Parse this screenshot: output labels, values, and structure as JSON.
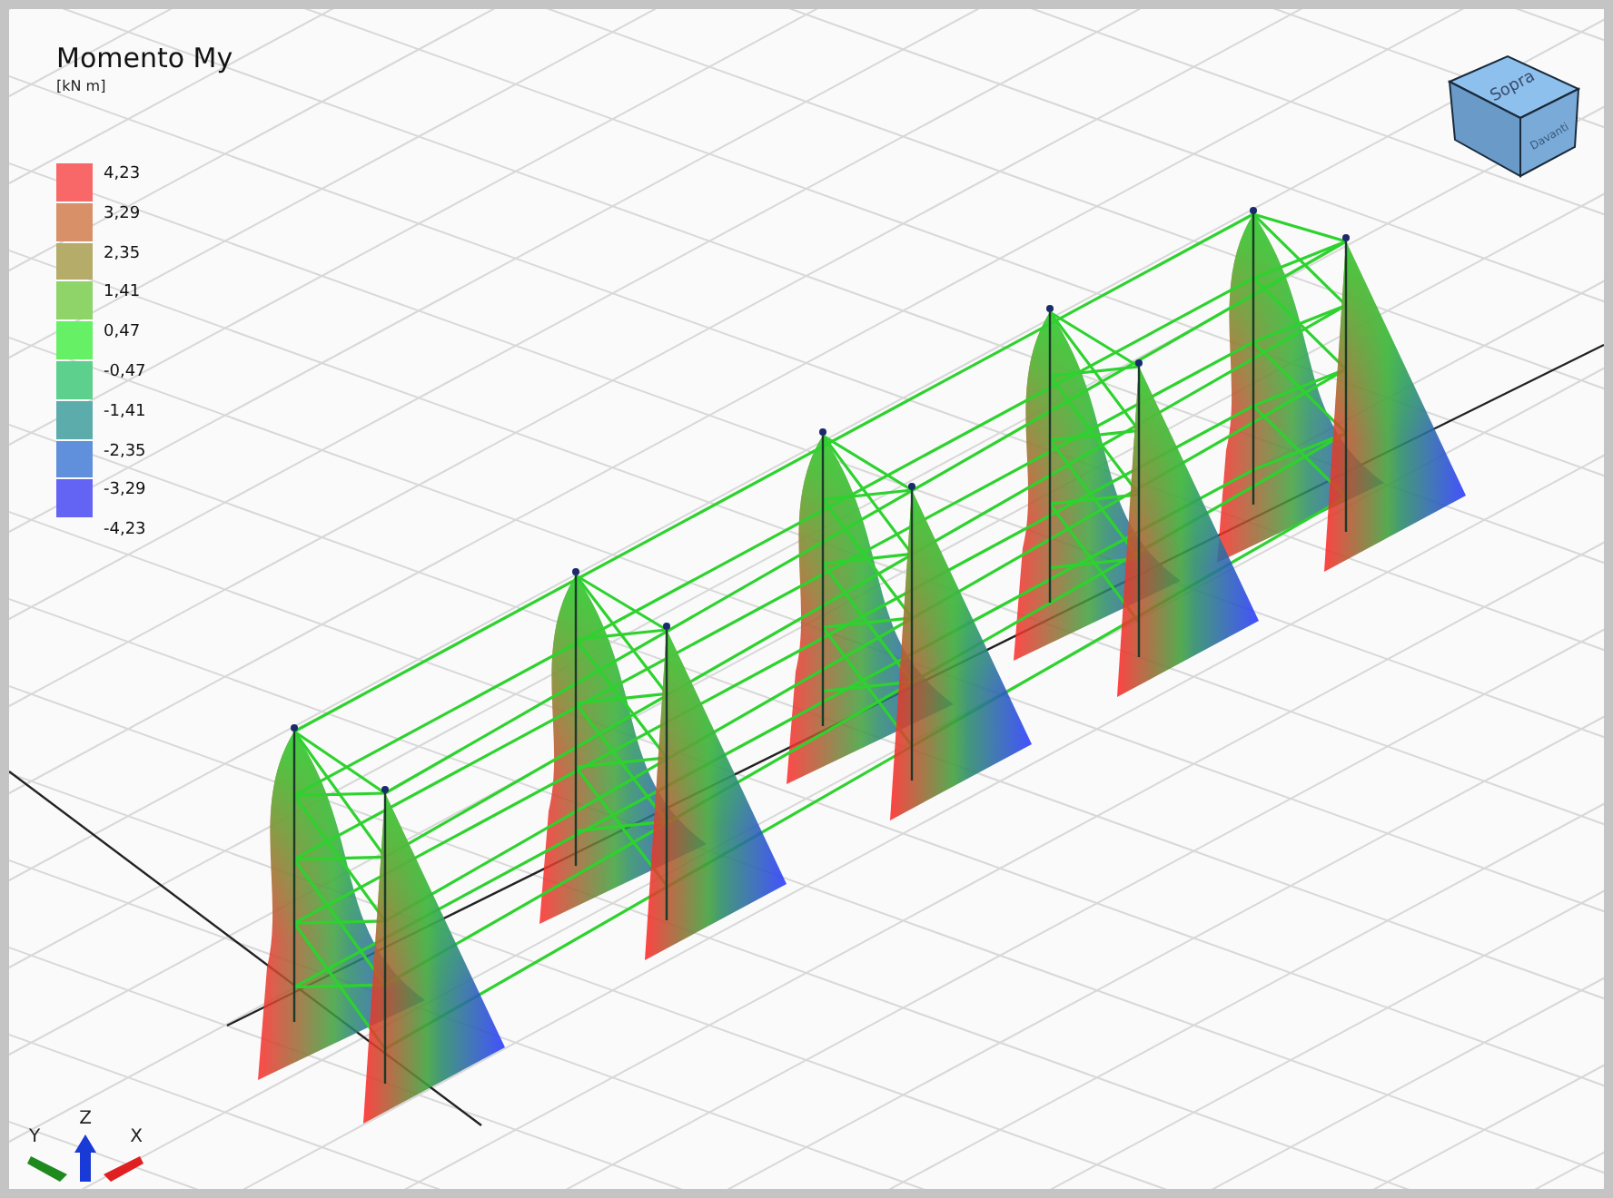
{
  "legend": {
    "title": "Momento My",
    "unit": "[kN m]",
    "swatches": [
      {
        "color": "#f86868"
      },
      {
        "color": "#d89068"
      },
      {
        "color": "#b4ac68"
      },
      {
        "color": "#8ed468"
      },
      {
        "color": "#66f066"
      },
      {
        "color": "#5cd08c"
      },
      {
        "color": "#5cacac"
      },
      {
        "color": "#6090dc"
      },
      {
        "color": "#6464f4"
      }
    ],
    "values": [
      "4,23",
      "3,29",
      "2,35",
      "1,41",
      "0,47",
      "-0,47",
      "-1,41",
      "-2,35",
      "-3,29",
      "-4,23"
    ]
  },
  "view_cube": {
    "top": "Sopra",
    "front": "Davanti"
  },
  "axes": [
    {
      "label": "Y",
      "color": "#1e8a1e"
    },
    {
      "label": "Z",
      "color": "#1a3ad8"
    },
    {
      "label": "X",
      "color": "#e02020"
    }
  ]
}
